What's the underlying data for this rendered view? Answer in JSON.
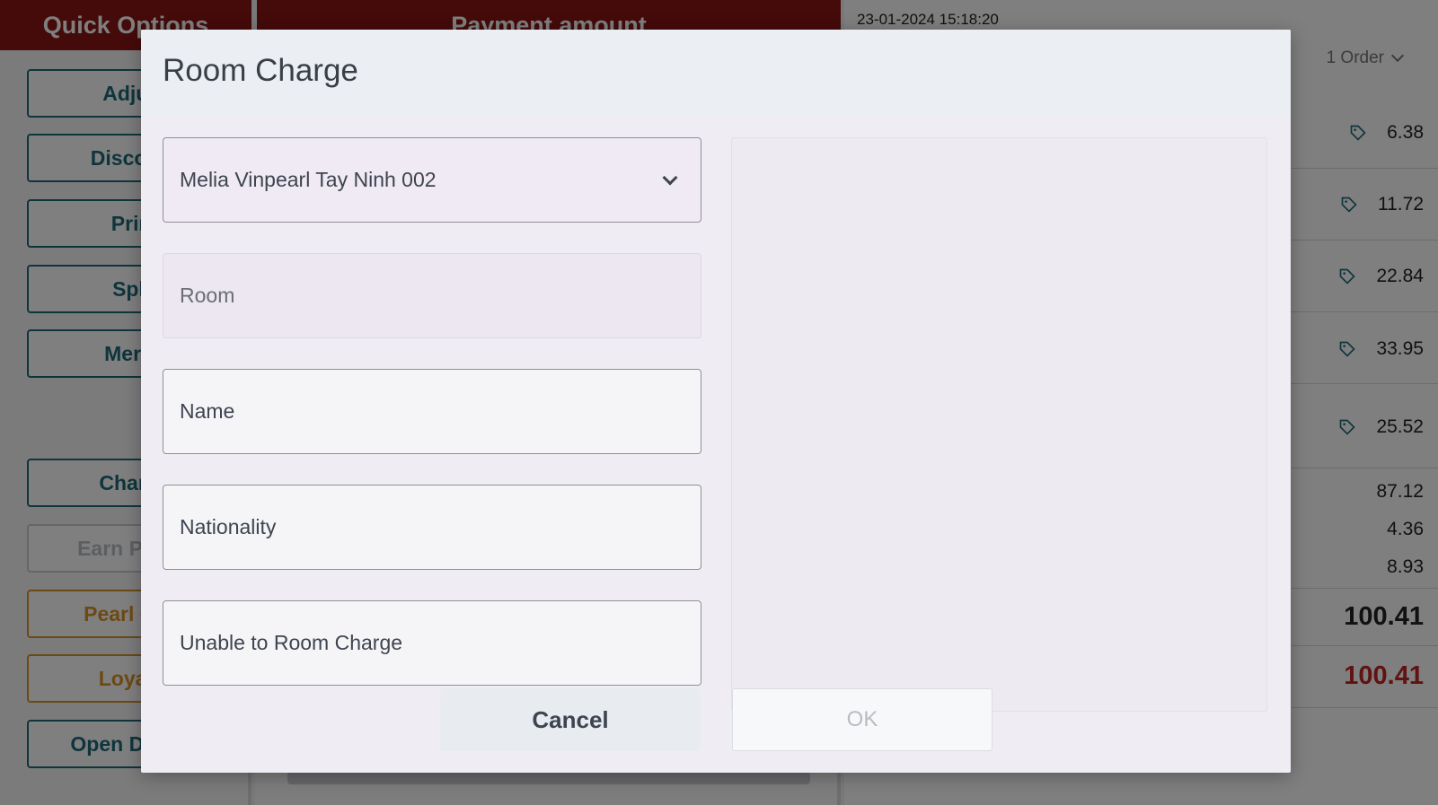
{
  "quick_options": {
    "title": "Quick Options",
    "buttons": [
      {
        "label": "Adjust",
        "state": "normal"
      },
      {
        "label": "Discount",
        "state": "normal"
      },
      {
        "label": "Print",
        "state": "normal"
      },
      {
        "label": "Split",
        "state": "normal"
      },
      {
        "label": "Merge",
        "state": "normal"
      },
      {
        "label": "Charge",
        "state": "normal"
      },
      {
        "label": "Earn Points",
        "state": "disabled"
      },
      {
        "label": "Pearl Club",
        "state": "gold"
      },
      {
        "label": "Loyalty",
        "state": "gold"
      },
      {
        "label": "Open Drawer",
        "state": "normal"
      }
    ]
  },
  "payment": {
    "title": "Payment amount"
  },
  "order_panel": {
    "datetime": "23-01-2024 15:18:20",
    "orders_label": "1 Order",
    "items": [
      "6.38",
      "11.72",
      "22.84",
      "33.95",
      "25.52"
    ],
    "subtotal": "87.12",
    "line2": "4.36",
    "line3": "8.93",
    "total": "100.41",
    "total_due": "100.41"
  },
  "dialog": {
    "title": "Room Charge",
    "property_select": "Melia Vinpearl Tay Ninh 002",
    "room_placeholder": "Room",
    "name_placeholder": "Name",
    "nationality_placeholder": "Nationality",
    "unable_label": "Unable to Room Charge",
    "cancel_label": "Cancel",
    "ok_label": "OK"
  },
  "colors": {
    "header_red": "#8a1515",
    "teal": "#1e6a78",
    "gold": "#d9932a",
    "total_red": "#c22626"
  }
}
